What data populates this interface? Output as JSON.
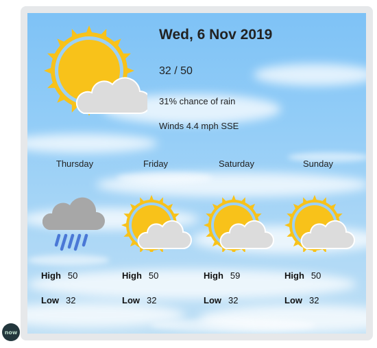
{
  "current": {
    "date": "Wed, 6 Nov 2019",
    "temps": "32 / 50",
    "rain": "31% chance of rain",
    "winds": "Winds 4.4 mph SSE",
    "icon": "partly-cloudy-icon"
  },
  "forecast": [
    {
      "day": "Thursday",
      "icon": "rain-icon",
      "high_label": "High",
      "high": "50",
      "low_label": "Low",
      "low": "32"
    },
    {
      "day": "Friday",
      "icon": "partly-cloudy-icon",
      "high_label": "High",
      "high": "50",
      "low_label": "Low",
      "low": "32"
    },
    {
      "day": "Saturday",
      "icon": "partly-cloudy-icon",
      "high_label": "High",
      "high": "59",
      "low_label": "Low",
      "low": "32"
    },
    {
      "day": "Sunday",
      "icon": "partly-cloudy-icon",
      "high_label": "High",
      "high": "50",
      "low_label": "Low",
      "low": "32"
    }
  ],
  "badge": {
    "text": "now",
    "icon": "servicenow-logo-icon"
  },
  "colors": {
    "sun": "#f8c21a",
    "sun_ring": "#f5a314",
    "cloud": "#dcdcdc",
    "rain": "#4a78d6",
    "sky": "#8cc8f6"
  }
}
